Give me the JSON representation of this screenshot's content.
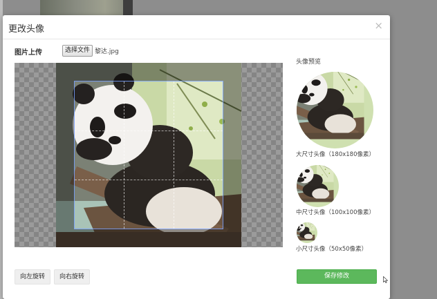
{
  "modal": {
    "title": "更改头像",
    "close_label": "×"
  },
  "upload": {
    "label": "图片上传",
    "choose_button": "选择文件",
    "file_name": "黎达.jpg"
  },
  "preview": {
    "title": "头像预览",
    "large_label": "大尺寸头像（180x180像素）",
    "medium_label": "中尺寸头像（100x100像素）",
    "small_label": "小尺寸头像（50x50像素）"
  },
  "actions": {
    "rotate_left": "向左旋转",
    "rotate_right": "向右旋转",
    "save": "保存修改"
  },
  "colors": {
    "save_button": "#5cb85c",
    "overlay": "#8d8d8d"
  },
  "icons": {
    "close": "close-icon",
    "cursor": "mouse-pointer-icon"
  }
}
